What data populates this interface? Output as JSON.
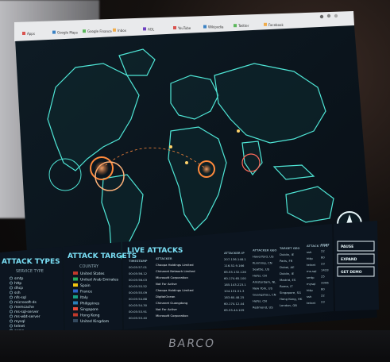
{
  "bookmarks": [
    "Apps",
    "Google Maps",
    "Google Finance",
    "Inbox",
    "AOL",
    "YouTube",
    "Wikipedia",
    "Twitter",
    "Facebook"
  ],
  "panels": {
    "attack_types": {
      "title": "ATTACK TYPES",
      "header": "SERVICE TYPE",
      "items": [
        "smtp",
        "http",
        "dhcp",
        "ssh",
        "nfs-sql",
        "microsoft-ds",
        "memcache",
        "ms-sql-server",
        "ms-wbt-server",
        "mysql",
        "telnet",
        "snmp"
      ]
    },
    "attack_targets": {
      "title": "ATTACK TARGETS",
      "header": "COUNTRY",
      "items": [
        "United States",
        "United Arab Emirates",
        "Spain",
        "France",
        "Italy",
        "Philippines",
        "Singapore",
        "Hong Kong",
        "United Kingdom"
      ]
    },
    "live_attacks": {
      "title": "LIVE ATTACKS",
      "headers": [
        "TIMESTAMP",
        "ATTACKER",
        "ATTACKER IP",
        "ATTACKER GEO",
        "TARGET GEO",
        "ATTACK TYPE",
        "PORT"
      ],
      "rows": [
        [
          "00:05:57.01",
          "Choopa Holdings Limited",
          "207.136.148.1",
          "Haverford, US",
          "Dublin, IE",
          "ssh",
          "22"
        ],
        [
          "00:05:56.12",
          "Chinanet Network Limited",
          "116.52.9.166",
          "Kunming, CN",
          "Paris, FR",
          "http",
          "80"
        ],
        [
          "00:05:56.03",
          "Microsoft Corporation",
          "65.55.132.126",
          "Seattle, US",
          "Dubai, AE",
          "telnet",
          "23"
        ],
        [
          "00:05:55.52",
          "Not For Active",
          "60.174.65.100",
          "Hefei, CN",
          "Dublin, IE",
          "ms-sql",
          "1433"
        ],
        [
          "00:05:55.09",
          "Choopa Holdings Limited",
          "185.143.223.1",
          "Amsterdam, NL",
          "Madrid, ES",
          "smtp",
          "25"
        ],
        [
          "00:05:54.88",
          "DigitalOcean",
          "104.131.51.3",
          "New York, US",
          "Rome, IT",
          "mysql",
          "3306"
        ],
        [
          "00:05:54.30",
          "Chinanet Guangdong",
          "183.60.48.25",
          "Guangzhou, CN",
          "Singapore, SG",
          "http",
          "80"
        ],
        [
          "00:05:53.91",
          "Not For Active",
          "60.174.12.44",
          "Hefei, CN",
          "Hong Kong, HK",
          "ssh",
          "22"
        ],
        [
          "00:05:53.40",
          "Microsoft Corporation",
          "65.55.44.109",
          "Redmond, US",
          "London, GB",
          "telnet",
          "23"
        ]
      ]
    }
  },
  "control_buttons": [
    "PAUSE",
    "EXPAND",
    "GET DEMO"
  ],
  "brand": "BARCO",
  "colors": {
    "map_line": "#4fe6d6",
    "map_fill": "#0f2a2f",
    "attack_orange": "#ff8a3c",
    "panel_bg": "#0c1520",
    "panel_title": "#7adff5"
  }
}
